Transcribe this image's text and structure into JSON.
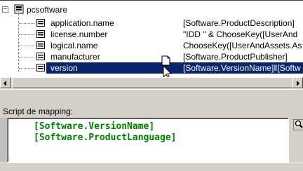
{
  "tree": {
    "root": {
      "label": "pcsoftware",
      "expander": "−",
      "icon": "class-icon"
    },
    "properties": [
      {
        "name": "application.name",
        "value": "[Software.ProductDescription]",
        "selected": false
      },
      {
        "name": "license.number",
        "value": "\"IDD \" & ChooseKey([UserAnd",
        "selected": false
      },
      {
        "name": "logical.name",
        "value": "ChooseKey([UserAndAssets.As",
        "selected": false
      },
      {
        "name": "manufacturer",
        "value": "[Software.ProductPublisher]",
        "selected": false
      },
      {
        "name": "version",
        "value": "[Software.VersionName]‖[Softw",
        "selected": true
      }
    ]
  },
  "script": {
    "label": "Script de mapping:",
    "lines": [
      "[Software.VersionName]",
      "[Software.ProductLanguage]"
    ]
  },
  "colors": {
    "selection": "#0a246a",
    "code": "#008000"
  }
}
